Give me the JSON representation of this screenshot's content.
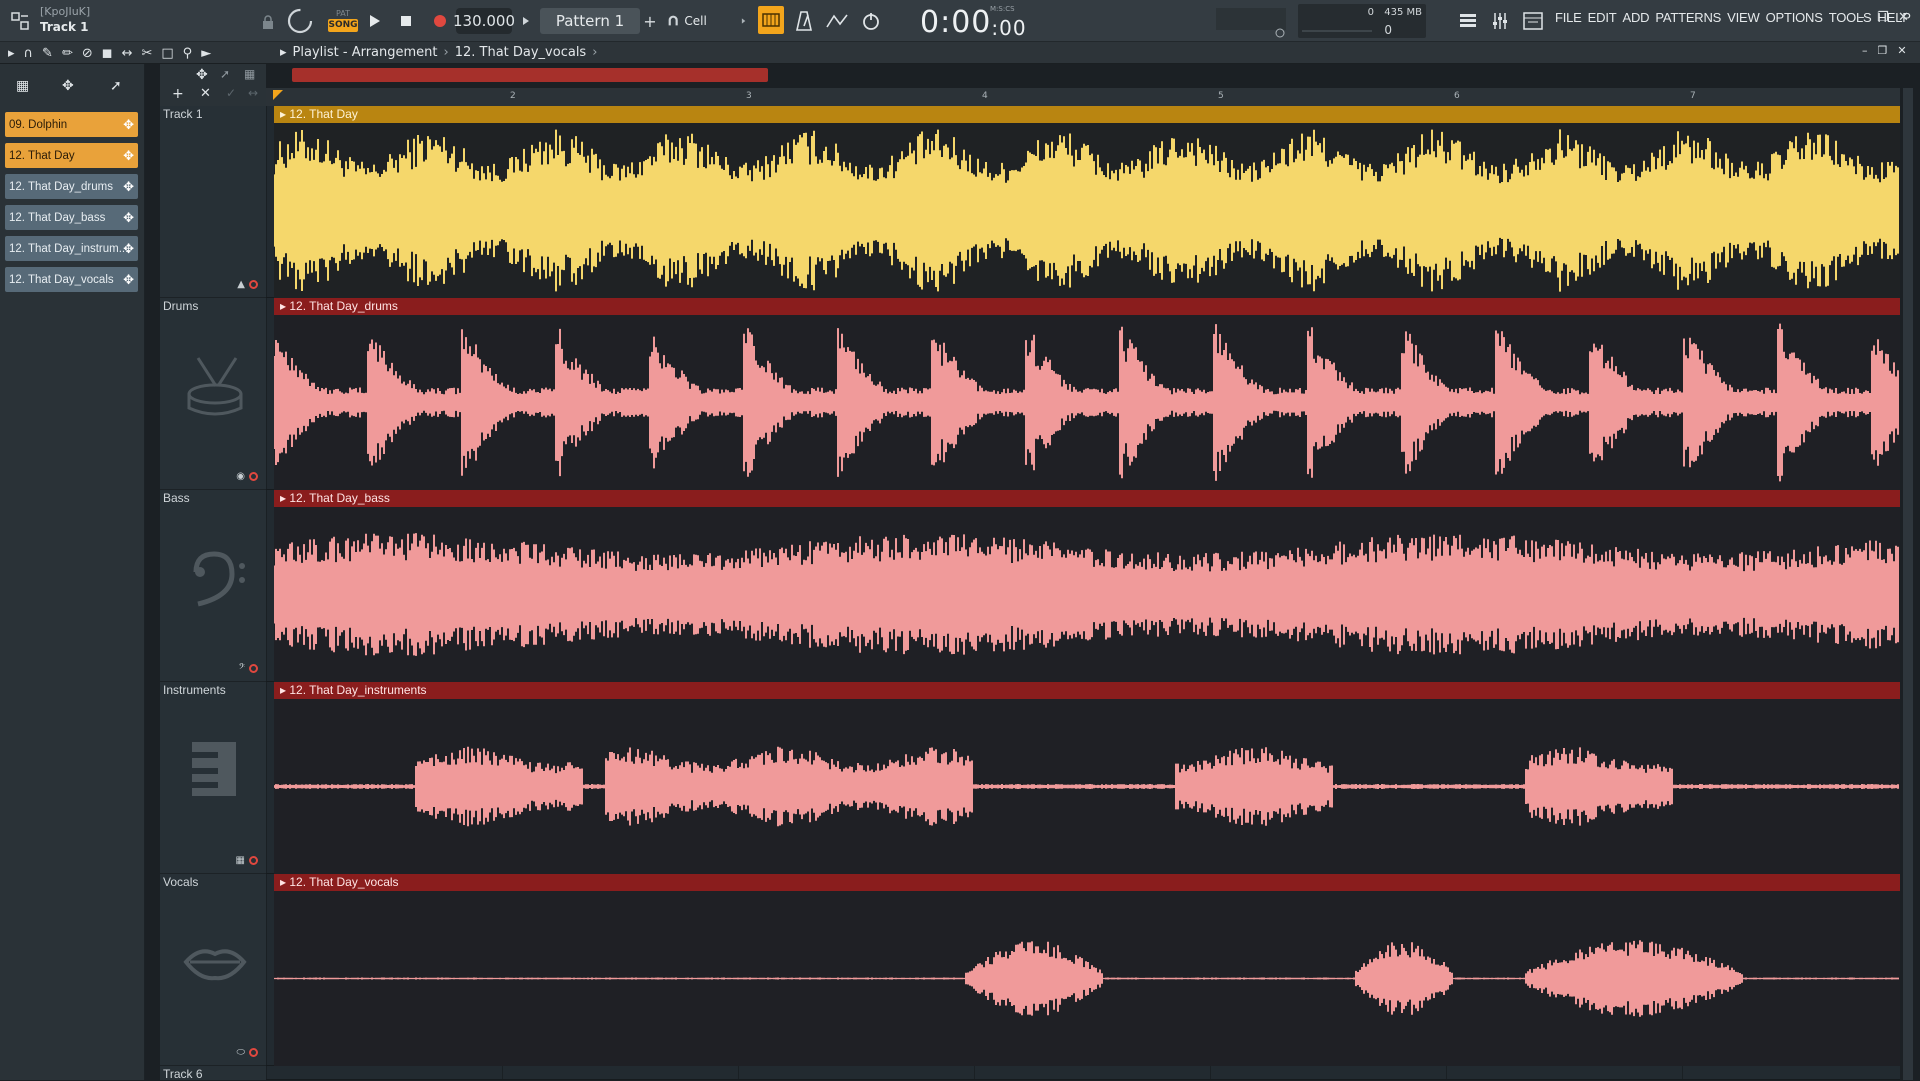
{
  "titlebar": {
    "user": "[KpoJIuK]",
    "track": "Track 1"
  },
  "transport": {
    "pat_label": "PAT",
    "song_label": "SONG",
    "tempo": "130.000",
    "pattern": "Pattern 1",
    "snap": "Cell",
    "time_main": "0:00",
    "time_sub": "00",
    "time_unit": "M:S:CS"
  },
  "monitor": {
    "cpu": "0",
    "memory": "435 MB",
    "polyphony": "0"
  },
  "menu": [
    "FILE",
    "EDIT",
    "ADD",
    "PATTERNS",
    "VIEW",
    "OPTIONS",
    "TOOLS",
    "HELP"
  ],
  "playlist": {
    "breadcrumb": [
      "Playlist - Arrangement",
      "12. That Day_vocals"
    ]
  },
  "picker": {
    "clips": [
      {
        "label": "09. Dolphin",
        "kind": "audio"
      },
      {
        "label": "12. That Day",
        "kind": "audio"
      },
      {
        "label": "12. That Day_drums",
        "kind": "pattern"
      },
      {
        "label": "12. That Day_bass",
        "kind": "pattern"
      },
      {
        "label": "12. That Day_instrum...",
        "kind": "pattern"
      },
      {
        "label": "12. That Day_vocals",
        "kind": "pattern"
      }
    ]
  },
  "ruler": {
    "bars": [
      "2",
      "3",
      "4",
      "5",
      "6",
      "7"
    ]
  },
  "tracks": [
    {
      "name": "Track 1",
      "clip": "12. That Day",
      "color": "#f5d76b"
    },
    {
      "name": "Drums",
      "clip": "12. That Day_drums",
      "color": "#f09a9a"
    },
    {
      "name": "Bass",
      "clip": "12. That Day_bass",
      "color": "#f09a9a"
    },
    {
      "name": "Instruments",
      "clip": "12. That Day_instruments",
      "color": "#f09a9a"
    },
    {
      "name": "Vocals",
      "clip": "12. That Day_vocals",
      "color": "#f09a9a"
    },
    {
      "name": "Track 6",
      "clip": "",
      "color": ""
    }
  ]
}
